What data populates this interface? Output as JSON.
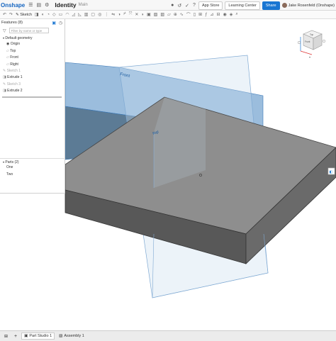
{
  "topbar": {
    "logo": "Onshape",
    "doc_name": "Identity",
    "branch": "Main",
    "app_store": "App Store",
    "learning_center": "Learning Center",
    "share": "Share",
    "user": "Jake Rosenfeld (Onshape)"
  },
  "toolbar": {
    "sketch": "Sketch"
  },
  "features": {
    "header": "Features (8)",
    "filter_placeholder": "Filter by name or type",
    "items": [
      {
        "label": "Default geometry"
      },
      {
        "label": "Origin"
      },
      {
        "label": "Top"
      },
      {
        "label": "Front"
      },
      {
        "label": "Right"
      },
      {
        "label": "Sketch 1"
      },
      {
        "label": "Extrude 1"
      },
      {
        "label": "Sketch 3"
      },
      {
        "label": "Extrude 2"
      }
    ]
  },
  "parts": {
    "header": "Parts (2)",
    "items": [
      {
        "label": "One"
      },
      {
        "label": "Two"
      }
    ]
  },
  "viewport": {
    "plane_front": "Front",
    "plane_right": "Rigl",
    "viewcube_front": "Front",
    "viewcube_top": "Top"
  },
  "tabs": [
    {
      "label": "Part Studio 1"
    },
    {
      "label": "Assembly 1"
    }
  ],
  "colors": {
    "plane_fill": "#7aa7d2",
    "part_top": "#8e8e8e",
    "part_side": "#585858",
    "accent": "#1976d2"
  }
}
